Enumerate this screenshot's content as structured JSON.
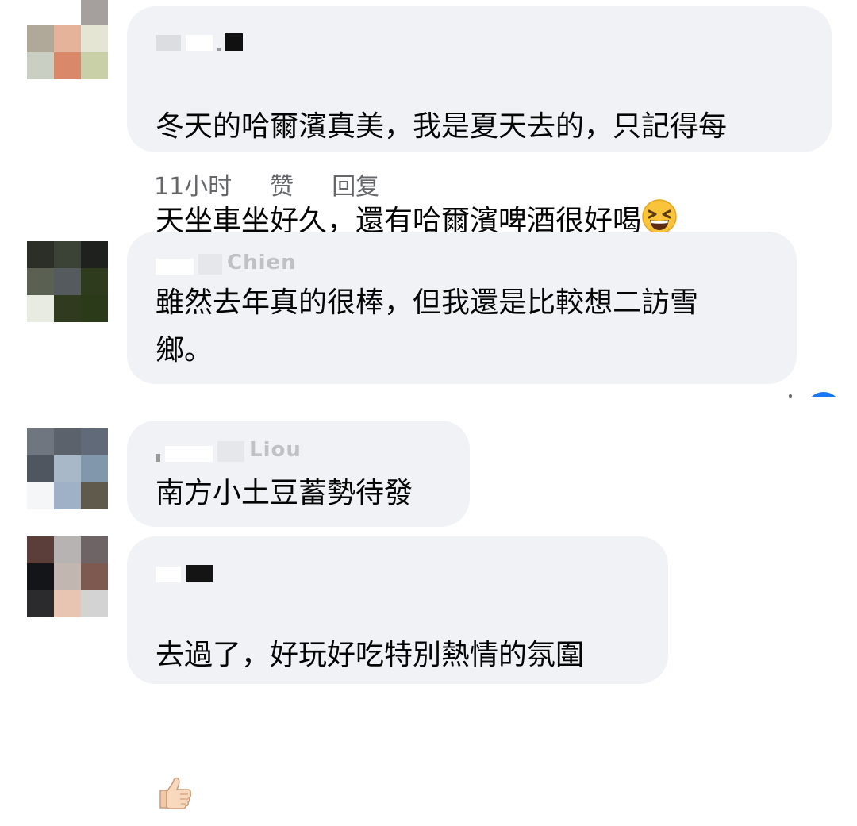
{
  "comments": [
    {
      "author": "",
      "text": "冬天的哈爾濱真美，我是夏天去的，只記得每\n天坐車坐好久，還有哈爾濱啤酒很好喝",
      "emoji": "grinning-squinting-face",
      "time": "11小时",
      "like": "赞",
      "reply": "回复"
    },
    {
      "author": "Chien",
      "text": "雖然去年真的很棒，但我還是比較想二訪雪\n鄉。"
    },
    {
      "author": "Liou",
      "text": "南方小土豆蓄勢待發"
    },
    {
      "author": "",
      "text": "去過了，好玩好吃特別熱情的氛圍",
      "emoji": "thumbs-up"
    }
  ],
  "colors": {
    "bubble": "#f0f2f5",
    "meta_text": "#65676b",
    "reaction_blue": "#1877f2"
  }
}
